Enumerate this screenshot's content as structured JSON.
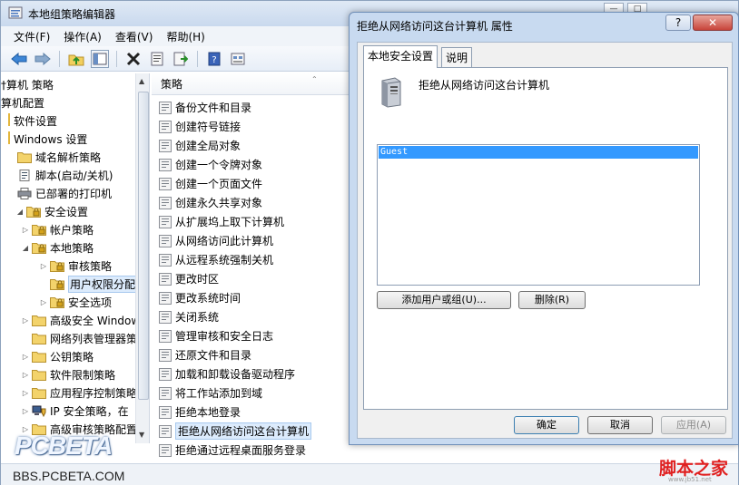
{
  "window": {
    "title": "本地组策略编辑器"
  },
  "menu": [
    "文件(F)",
    "操作(A)",
    "查看(V)",
    "帮助(H)"
  ],
  "tree": {
    "items": [
      {
        "label": "†算机 策略",
        "indent": 0,
        "arrow": "",
        "icon": "none"
      },
      {
        "label": "算机配置",
        "indent": 0,
        "arrow": "",
        "icon": "none"
      },
      {
        "label": "软件设置",
        "indent": 0,
        "arrow": "",
        "icon": "bar"
      },
      {
        "label": "Windows 设置",
        "indent": 0,
        "arrow": "",
        "icon": "bar"
      },
      {
        "label": "域名解析策略",
        "indent": 1,
        "arrow": "",
        "icon": "folder"
      },
      {
        "label": "脚本(启动/关机)",
        "indent": 1,
        "arrow": "",
        "icon": "doc"
      },
      {
        "label": "已部署的打印机",
        "indent": 1,
        "arrow": "",
        "icon": "printer"
      },
      {
        "label": "安全设置",
        "indent": 1,
        "arrow": "down",
        "icon": "lockfolder"
      },
      {
        "label": "帐户策略",
        "indent": 2,
        "arrow": "right",
        "icon": "lockfolder"
      },
      {
        "label": "本地策略",
        "indent": 2,
        "arrow": "down",
        "icon": "lockfolder"
      },
      {
        "label": "审核策略",
        "indent": 3,
        "arrow": "right",
        "icon": "lockfolder"
      },
      {
        "label": "用户权限分配",
        "indent": 3,
        "arrow": "",
        "icon": "lockfolder",
        "selected": true
      },
      {
        "label": "安全选项",
        "indent": 3,
        "arrow": "right",
        "icon": "lockfolder"
      },
      {
        "label": "高级安全 Windows",
        "indent": 2,
        "arrow": "right",
        "icon": "folder"
      },
      {
        "label": "网络列表管理器策略",
        "indent": 2,
        "arrow": "",
        "icon": "folder"
      },
      {
        "label": "公钥策略",
        "indent": 2,
        "arrow": "right",
        "icon": "folder"
      },
      {
        "label": "软件限制策略",
        "indent": 2,
        "arrow": "right",
        "icon": "folder"
      },
      {
        "label": "应用程序控制策略",
        "indent": 2,
        "arrow": "right",
        "icon": "folder"
      },
      {
        "label": "IP 安全策略，在",
        "indent": 2,
        "arrow": "right",
        "icon": "shield"
      },
      {
        "label": "高级审核策略配置",
        "indent": 2,
        "arrow": "right",
        "icon": "folder"
      }
    ]
  },
  "list": {
    "header": "策略",
    "items": [
      "备份文件和目录",
      "创建符号链接",
      "创建全局对象",
      "创建一个令牌对象",
      "创建一个页面文件",
      "创建永久共享对象",
      "从扩展坞上取下计算机",
      "从网络访问此计算机",
      "从远程系统强制关机",
      "更改时区",
      "更改系统时间",
      "关闭系统",
      "管理审核和安全日志",
      "还原文件和目录",
      "加载和卸载设备驱动程序",
      "将工作站添加到域",
      "拒绝本地登录",
      "拒绝从网络访问这台计算机",
      "拒绝通过远程桌面服务登录"
    ],
    "selected_index": 17
  },
  "dialog": {
    "title": "拒绝从网络访问这台计算机 属性",
    "help": "?",
    "tabs": [
      "本地安全设置",
      "说明"
    ],
    "policy_name": "拒绝从网络访问这台计算机",
    "users": [
      "Guest"
    ],
    "add_button": "添加用户或组(U)...",
    "remove_button": "删除(R)",
    "ok_button": "确定",
    "cancel_button": "取消",
    "apply_button": "应用(A)"
  },
  "watermark": {
    "pcbeta": "PCBETA",
    "pcbeta_url": "BBS.PCBETA.COM",
    "jb51": "脚本之家",
    "jb51_url": "www.jb51.net"
  },
  "colors": {
    "selection": "#3399ff",
    "tree_selection": "#dcebfc",
    "title_bar": "#c9d9ee"
  }
}
